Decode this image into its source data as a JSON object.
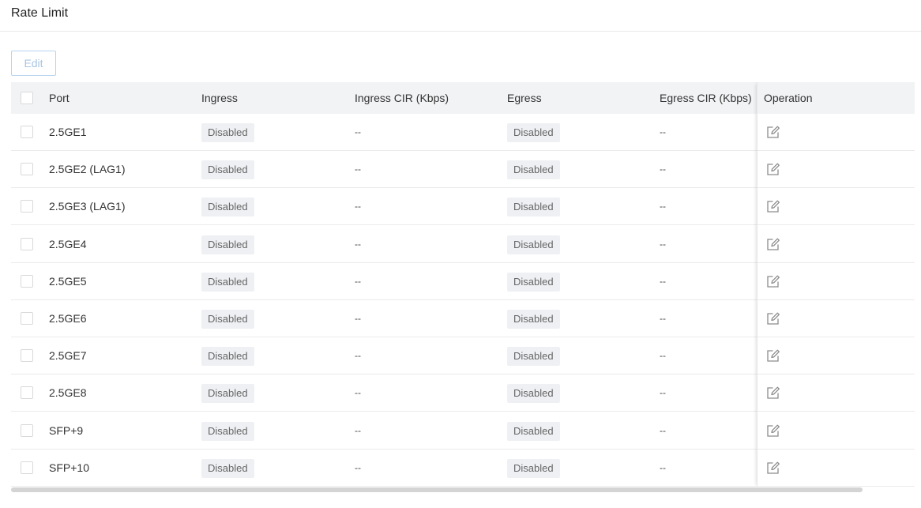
{
  "page": {
    "title": "Rate Limit"
  },
  "toolbar": {
    "edit_label": "Edit"
  },
  "table": {
    "columns": {
      "port": "Port",
      "ingress": "Ingress",
      "ingress_cir": "Ingress CIR (Kbps)",
      "egress": "Egress",
      "egress_cir": "Egress CIR (Kbps)",
      "operation": "Operation"
    },
    "rows": [
      {
        "port": "2.5GE1",
        "ingress": "Disabled",
        "ingress_cir": "--",
        "egress": "Disabled",
        "egress_cir": "--"
      },
      {
        "port": "2.5GE2 (LAG1)",
        "ingress": "Disabled",
        "ingress_cir": "--",
        "egress": "Disabled",
        "egress_cir": "--"
      },
      {
        "port": "2.5GE3 (LAG1)",
        "ingress": "Disabled",
        "ingress_cir": "--",
        "egress": "Disabled",
        "egress_cir": "--"
      },
      {
        "port": "2.5GE4",
        "ingress": "Disabled",
        "ingress_cir": "--",
        "egress": "Disabled",
        "egress_cir": "--"
      },
      {
        "port": "2.5GE5",
        "ingress": "Disabled",
        "ingress_cir": "--",
        "egress": "Disabled",
        "egress_cir": "--"
      },
      {
        "port": "2.5GE6",
        "ingress": "Disabled",
        "ingress_cir": "--",
        "egress": "Disabled",
        "egress_cir": "--"
      },
      {
        "port": "2.5GE7",
        "ingress": "Disabled",
        "ingress_cir": "--",
        "egress": "Disabled",
        "egress_cir": "--"
      },
      {
        "port": "2.5GE8",
        "ingress": "Disabled",
        "ingress_cir": "--",
        "egress": "Disabled",
        "egress_cir": "--"
      },
      {
        "port": "SFP+9",
        "ingress": "Disabled",
        "ingress_cir": "--",
        "egress": "Disabled",
        "egress_cir": "--"
      },
      {
        "port": "SFP+10",
        "ingress": "Disabled",
        "ingress_cir": "--",
        "egress": "Disabled",
        "egress_cir": "--"
      }
    ],
    "row_icon": "edit-icon"
  },
  "colors": {
    "header_bg": "#f2f3f5",
    "badge_bg": "#eef0f3",
    "edit_button_border": "#b7d3ee",
    "edit_button_text": "#a9c6e3"
  }
}
